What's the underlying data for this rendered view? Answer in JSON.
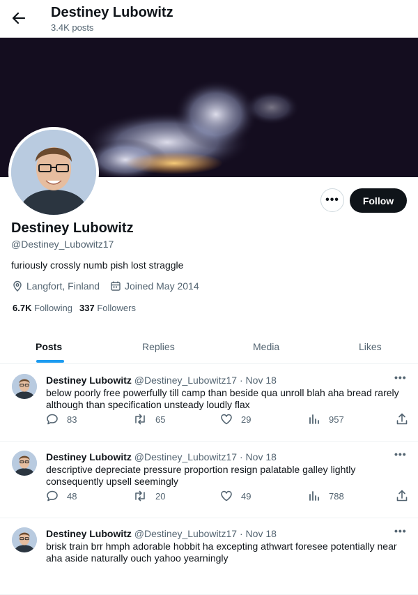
{
  "header": {
    "title": "Destiney Lubowitz",
    "subtitle": "3.4K posts"
  },
  "profile": {
    "name": "Destiney Lubowitz",
    "handle": "@Destiney_Lubowitz17",
    "bio": "furiously crossly numb pish lost straggle",
    "location": "Langfort, Finland",
    "joined": "Joined May 2014",
    "following_count": "6.7K",
    "following_label": "Following",
    "followers_count": "337",
    "followers_label": "Followers",
    "follow_label": "Follow",
    "more_label": "•••"
  },
  "tabs": [
    {
      "label": "Posts",
      "active": true
    },
    {
      "label": "Replies",
      "active": false
    },
    {
      "label": "Media",
      "active": false
    },
    {
      "label": "Likes",
      "active": false
    }
  ],
  "posts": [
    {
      "author": "Destiney Lubowitz",
      "handle": "@Destiney_Lubowitz17",
      "dot": "·",
      "date": "Nov 18",
      "text": "below poorly free powerfully till camp than beside qua unroll blah aha bread rarely although than specification unsteady loudly flax",
      "replies": "83",
      "reposts": "65",
      "likes": "29",
      "views": "957",
      "more": "•••"
    },
    {
      "author": "Destiney Lubowitz",
      "handle": "@Destiney_Lubowitz17",
      "dot": "·",
      "date": "Nov 18",
      "text": "descriptive depreciate pressure proportion resign palatable galley lightly consequently upsell seemingly",
      "replies": "48",
      "reposts": "20",
      "likes": "49",
      "views": "788",
      "more": "•••"
    },
    {
      "author": "Destiney Lubowitz",
      "handle": "@Destiney_Lubowitz17",
      "dot": "·",
      "date": "Nov 18",
      "text": "brisk train brr hmph adorable hobbit ha excepting athwart foresee potentially near aha aside naturally ouch yahoo yearningly",
      "more": "•••"
    }
  ],
  "icons": {
    "back": "arrow-left-icon",
    "location": "location-pin-icon",
    "calendar": "calendar-icon",
    "reply": "reply-icon",
    "repost": "repost-icon",
    "like": "heart-icon",
    "views": "views-chart-icon",
    "share": "share-icon"
  },
  "colors": {
    "accent": "#1d9bf0",
    "text_primary": "#0f1419",
    "text_secondary": "#536471",
    "follow_button": "#0f1419",
    "banner_background": "#140d1f"
  }
}
